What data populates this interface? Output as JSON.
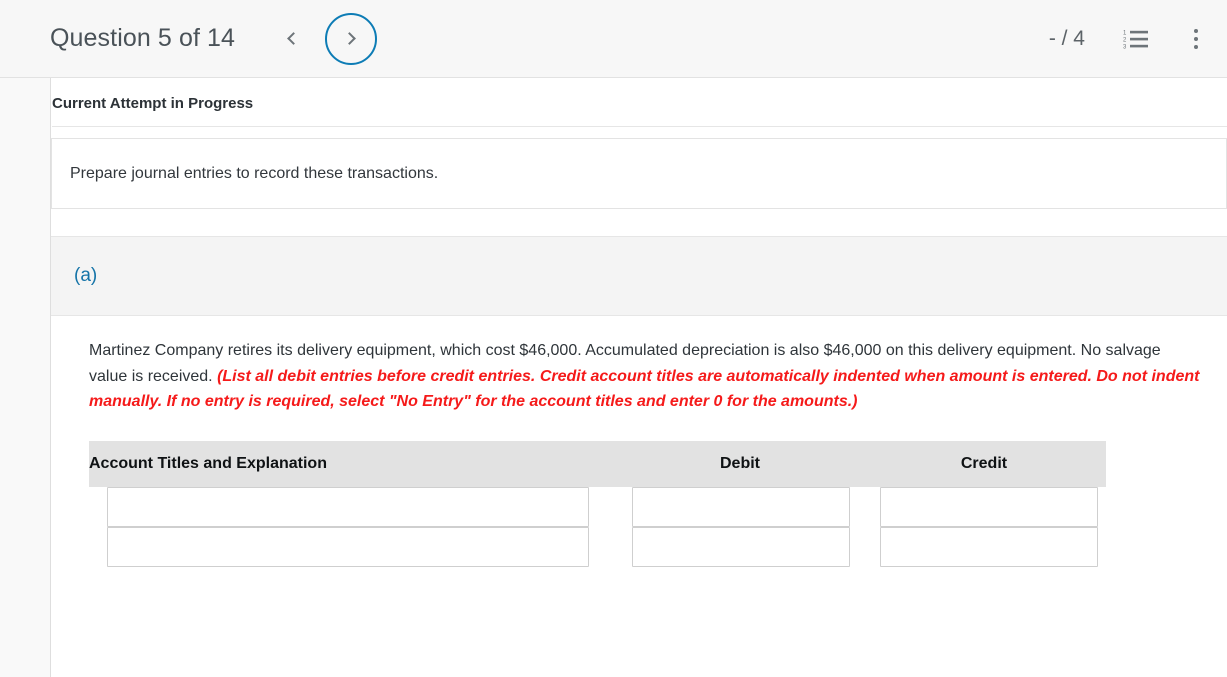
{
  "header": {
    "question_title": "Question 5 of 14",
    "prev_label": "‹",
    "next_label": "›",
    "score": "- / 4",
    "list_icon_name": "numbered-list-icon",
    "menu_icon_name": "kebab-menu-icon",
    "accent_color": "#0d7cb5",
    "title_color": "#4a5258"
  },
  "attempt": {
    "status": "Current Attempt in Progress"
  },
  "prompt": {
    "text": "Prepare journal entries to record these transactions."
  },
  "part": {
    "label": "(a)",
    "label_color": "#1574a8"
  },
  "question": {
    "body_text": "Martinez Company retires its delivery equipment, which cost $46,000. Accumulated depreciation is also $46,000 on this delivery equipment. No salvage value is received. ",
    "instruction_text": "(List all debit entries before credit entries. Credit account titles are automatically indented when amount is entered. Do not indent manually. If no entry is required, select \"No Entry\" for the account titles and enter 0 for the amounts.)",
    "instruction_color": "#f51a1a"
  },
  "journal": {
    "columns": [
      {
        "key": "account",
        "label": "Account Titles and Explanation"
      },
      {
        "key": "debit",
        "label": "Debit"
      },
      {
        "key": "credit",
        "label": "Credit"
      }
    ],
    "rows": [
      {
        "account": "",
        "debit": "",
        "credit": ""
      },
      {
        "account": "",
        "debit": "",
        "credit": ""
      }
    ],
    "header_background": "#e2e2e2"
  }
}
